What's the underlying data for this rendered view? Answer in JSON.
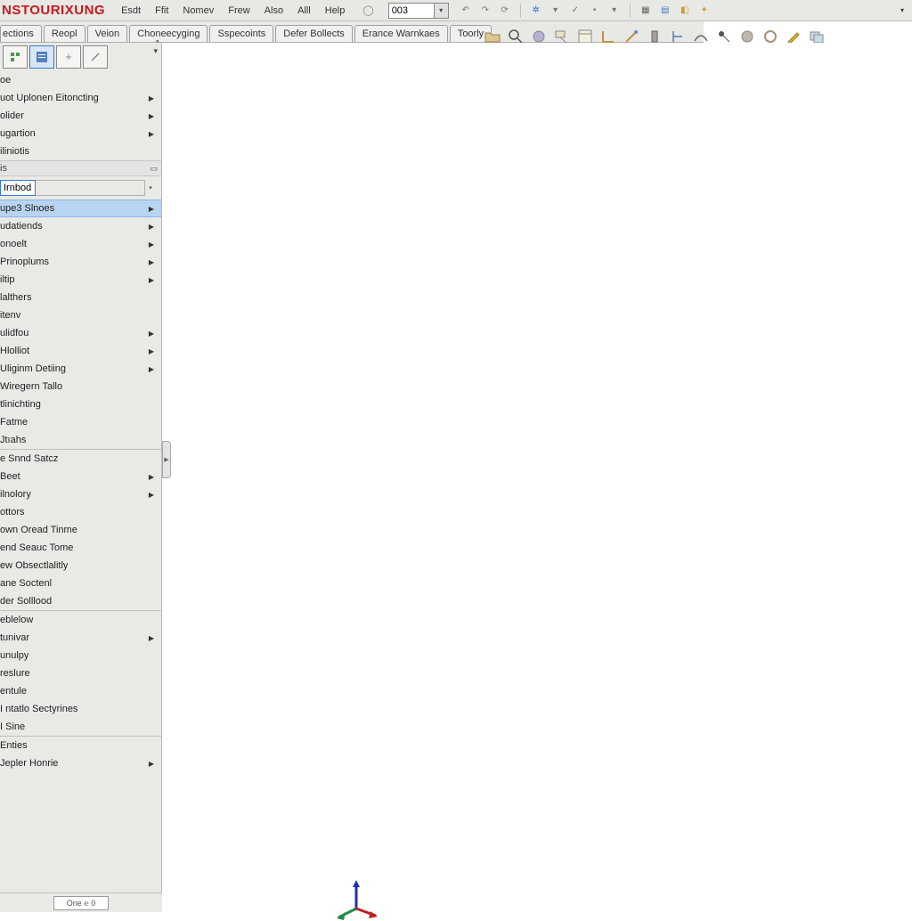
{
  "app": {
    "title": "NSTOURIXUNG"
  },
  "menu": [
    "Esdt",
    "Ffit",
    "Nomev",
    "Frew",
    "Also",
    "Alll",
    "Help"
  ],
  "combo_value": "003",
  "tabs": [
    "ections",
    "Reopl",
    "Veion",
    "Choneecyging",
    "Sspecoints",
    "Defer Bollects",
    "Erance Warnkaes",
    "Toorly"
  ],
  "sidebar": {
    "input": "Irnbod",
    "groups": [
      {
        "items": [
          {
            "label": "oe"
          },
          {
            "label": "uot Uplonen Eitoncting",
            "arrow": true
          },
          {
            "label": "olider",
            "arrow": true
          },
          {
            "label": "ugartion",
            "arrow": true
          },
          {
            "label": "iliniotis"
          }
        ]
      },
      {
        "header": "is"
      },
      {
        "input_row": true
      },
      {
        "items": [
          {
            "label": "upe3 Slnoes",
            "arrow": true,
            "selected": true
          },
          {
            "label": "udatiends",
            "arrow": true
          },
          {
            "label": "onoelt",
            "arrow": true
          },
          {
            "label": "Prinoplums",
            "arrow": true
          },
          {
            "label": "iltip",
            "arrow": true
          },
          {
            "label": "lalthers"
          },
          {
            "label": "itenv"
          },
          {
            "label": "ulidfou",
            "arrow": true
          },
          {
            "label": "Hlolliot",
            "arrow": true
          },
          {
            "label": "Uliginm Detiing",
            "arrow": true
          },
          {
            "label": "Wiregern Tallo"
          },
          {
            "label": "tlinichting"
          },
          {
            "label": "Fatme"
          },
          {
            "label": "Jtıahs"
          }
        ]
      },
      {
        "sep": true
      },
      {
        "items": [
          {
            "label": "e Snnd Satcz"
          },
          {
            "label": "Beet",
            "arrow": true
          },
          {
            "label": "ilnolory",
            "arrow": true
          },
          {
            "label": "ottors"
          },
          {
            "label": "own Oread Tinme"
          },
          {
            "label": "end Seauc Tome"
          },
          {
            "label": "ew Obsectlalitly"
          },
          {
            "label": "ane Soctenl"
          },
          {
            "label": "der Solllood"
          }
        ]
      },
      {
        "sep": true
      },
      {
        "items": [
          {
            "label": "eblelow"
          },
          {
            "label": "tunivar",
            "arrow": true
          },
          {
            "label": "unulpy"
          },
          {
            "label": "reslure"
          },
          {
            "label": "entule"
          },
          {
            "label": "I ntatlo Sectyrines"
          },
          {
            "label": "I Sine"
          }
        ]
      },
      {
        "sep": true
      },
      {
        "items": [
          {
            "label": "Enties"
          },
          {
            "label": "Jepler Honrie",
            "arrow": true
          }
        ]
      }
    ]
  },
  "status": "One ℮ 0"
}
